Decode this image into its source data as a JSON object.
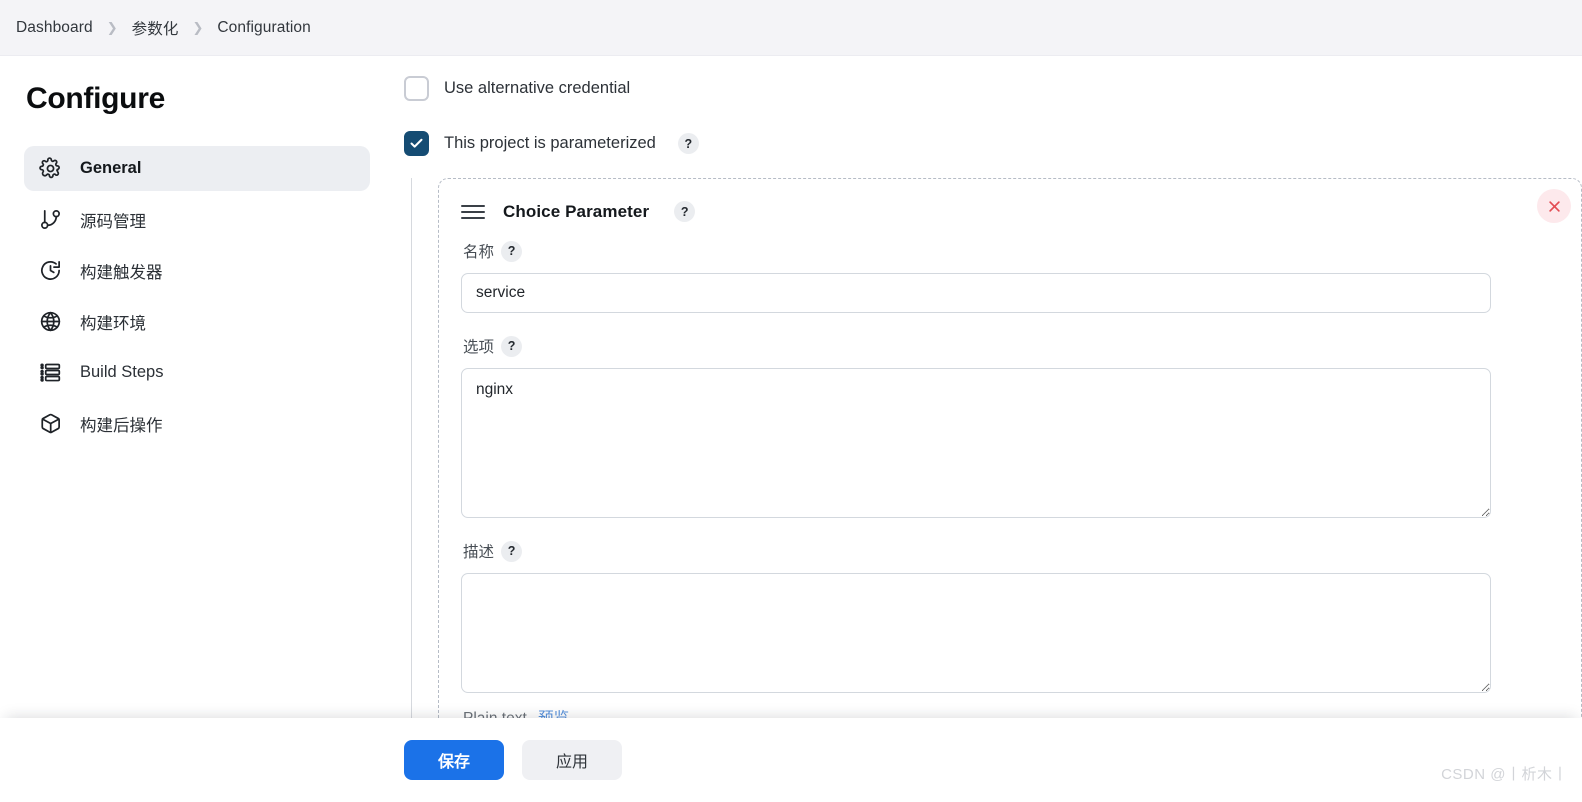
{
  "breadcrumb": {
    "items": [
      {
        "label": "Dashboard"
      },
      {
        "label": "参数化"
      },
      {
        "label": "Configuration"
      }
    ],
    "separator": "❯"
  },
  "sidebar": {
    "title": "Configure",
    "items": [
      {
        "label": "General",
        "icon": "gear-icon",
        "active": true
      },
      {
        "label": "源码管理",
        "icon": "git-branch-icon",
        "active": false
      },
      {
        "label": "构建触发器",
        "icon": "clock-icon",
        "active": false
      },
      {
        "label": "构建环境",
        "icon": "globe-icon",
        "active": false
      },
      {
        "label": "Build Steps",
        "icon": "list-icon",
        "active": false
      },
      {
        "label": "构建后操作",
        "icon": "package-icon",
        "active": false
      }
    ]
  },
  "main": {
    "checkboxes": [
      {
        "label": "Use alternative credential",
        "checked": false,
        "help": false
      },
      {
        "label": "This project is parameterized",
        "checked": true,
        "help": true
      }
    ],
    "help_glyph": "?",
    "parameter": {
      "title": "Choice Parameter",
      "delete_label": "×",
      "name_field": {
        "label": "名称",
        "value": "service",
        "placeholder": ""
      },
      "options_field": {
        "label": "选项",
        "value": "nginx",
        "placeholder": ""
      },
      "description_field": {
        "label": "描述",
        "value": "",
        "placeholder": ""
      },
      "plain_text_label": "Plain text",
      "preview_label": "预览"
    }
  },
  "footer": {
    "save_label": "保存",
    "apply_label": "应用"
  },
  "watermark": "CSDN @丨析木丨",
  "colors": {
    "accent_blue": "#1b72e8",
    "checkbox_navy": "#154c73",
    "link_blue": "#5a93dd",
    "delete_red": "#e34c53",
    "delete_bg": "#fde9ec",
    "breadcrumb_bg": "#f4f4f7",
    "active_item_bg": "#eceef2"
  }
}
